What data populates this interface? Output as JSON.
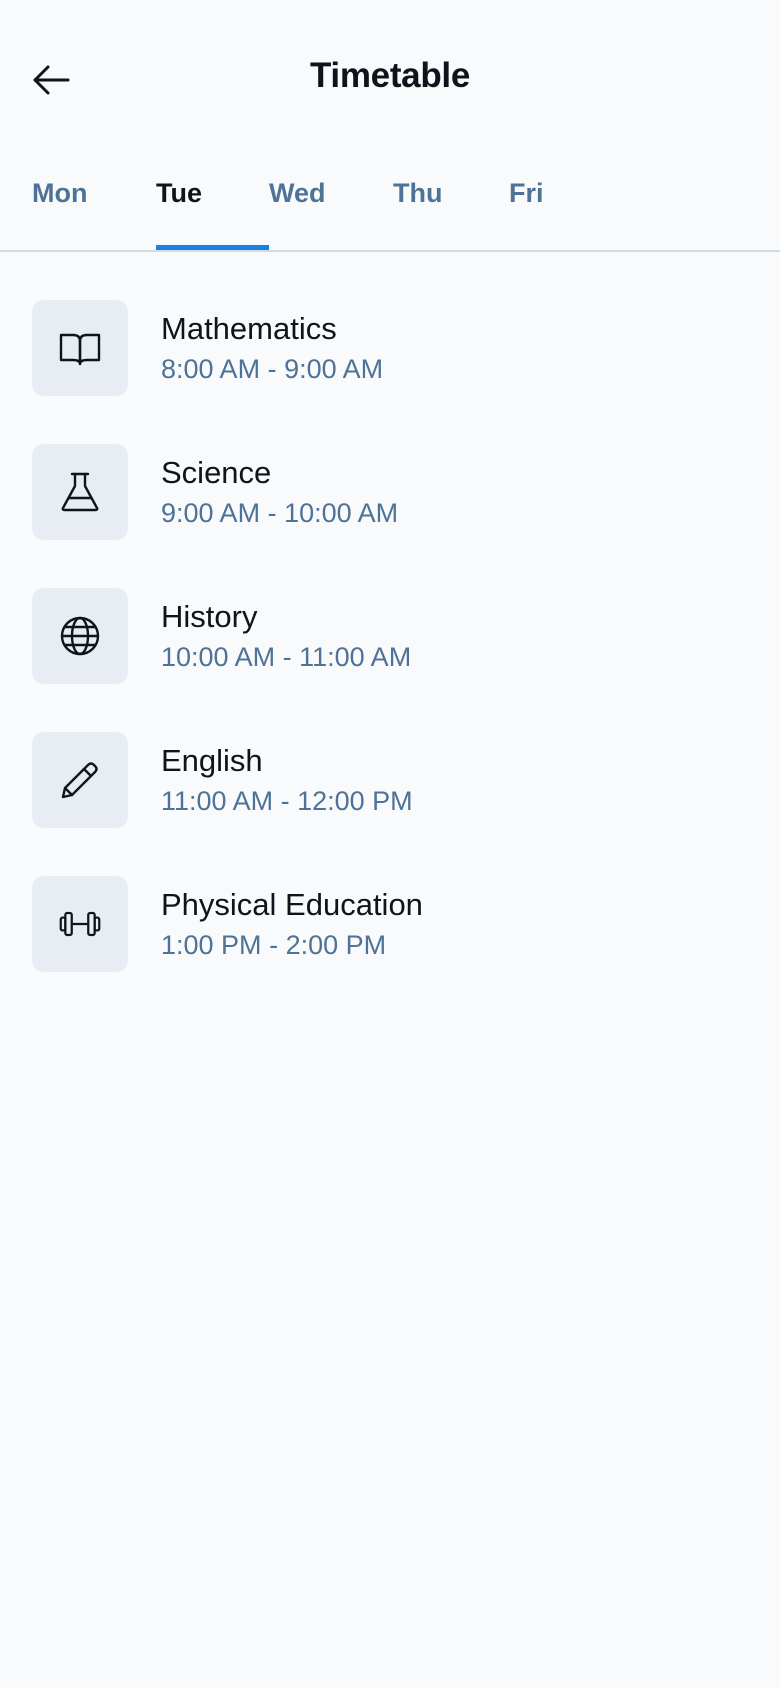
{
  "header": {
    "title": "Timetable",
    "back_icon": "arrow-left-icon"
  },
  "tabs": [
    {
      "label": "Mon",
      "active": false
    },
    {
      "label": "Tue",
      "active": true
    },
    {
      "label": "Wed",
      "active": false
    },
    {
      "label": "Thu",
      "active": false
    },
    {
      "label": "Fri",
      "active": false
    }
  ],
  "classes": [
    {
      "name": "Mathematics",
      "start": "8:00 AM",
      "end": "9:00 AM",
      "icon": "book-open-icon"
    },
    {
      "name": "Science",
      "start": "9:00 AM",
      "end": "10:00 AM",
      "icon": "flask-icon"
    },
    {
      "name": "History",
      "start": "10:00 AM",
      "end": "11:00 AM",
      "icon": "globe-icon"
    },
    {
      "name": "English",
      "start": "11:00 AM",
      "end": "12:00 PM",
      "icon": "pencil-icon"
    },
    {
      "name": "Physical Education",
      "start": "1:00 PM",
      "end": "2:00 PM",
      "icon": "barbell-icon"
    }
  ],
  "time_separator": "-",
  "colors": {
    "background": "#f8fafc",
    "text_primary": "#0e141b",
    "text_secondary": "#4e7397",
    "accent": "#1980e6",
    "icon_tile": "#e7edf3",
    "divider": "#d0dbe7"
  }
}
